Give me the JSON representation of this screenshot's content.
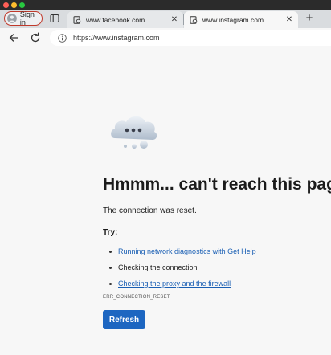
{
  "browser": {
    "profile_label": "Sign in",
    "tabs": [
      {
        "title": "www.facebook.com",
        "active": false
      },
      {
        "title": "www.instagram.com",
        "active": true
      }
    ],
    "address": "https://www.instagram.com"
  },
  "error_page": {
    "headline": "Hmmm... can't reach this page",
    "reason": "The connection was reset.",
    "try_label": "Try:",
    "tips": [
      {
        "text": "Running network diagnostics with Get Help",
        "link": true
      },
      {
        "text": "Checking the connection",
        "link": false
      },
      {
        "text": "Checking the proxy and the firewall",
        "link": true
      }
    ],
    "error_code": "ERR_CONNECTION_RESET",
    "refresh_label": "Refresh"
  },
  "colors": {
    "accent": "#1d66c1",
    "link": "#1a5fb4",
    "profile_outline": "#c0392b"
  },
  "icons": {
    "profile": "avatar-icon",
    "tab_actions": "tab-actions-icon",
    "favicon": "page-favicon-icon",
    "close": "close-icon",
    "new_tab": "plus-icon",
    "back": "back-arrow-icon",
    "reload": "reload-icon",
    "site_info": "info-icon",
    "error_art": "cloud-icon"
  }
}
